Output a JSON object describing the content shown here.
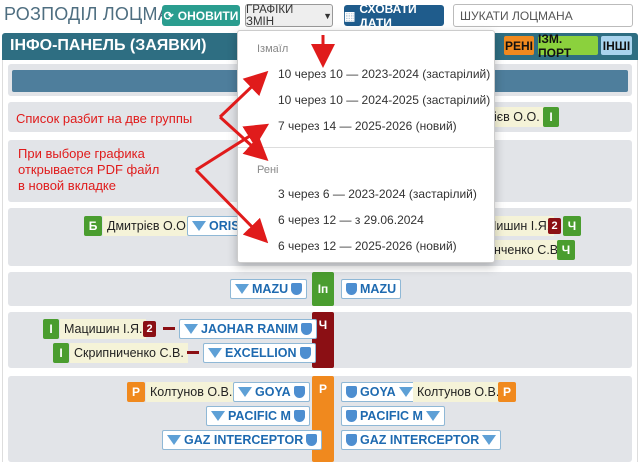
{
  "header": {
    "title": "РОЗПОДІЛ ЛОЦМАНІВ",
    "refresh_label": "ОНОВИТИ",
    "schedules_label": "ГРАФІКИ ЗМІН",
    "hide_dates_label": "СХОВАТИ ДАТИ",
    "search_placeholder": "ШУКАТИ ЛОЦМАНА"
  },
  "panel": {
    "title": "ІНФО-ПАНЕЛЬ (ЗАЯВКИ)",
    "tags": [
      "РЕНІ",
      "ІЗМ. ПОРТ",
      "ІНШІ"
    ]
  },
  "dropdown": {
    "groups": [
      {
        "name": "Ізмаїл",
        "items": [
          "10 через 10 — 2023-2024 (застарілий)",
          "10 через 10 — 2024-2025 (застарілий)",
          "7 через 14 — 2025-2026 (новий)"
        ]
      },
      {
        "name": "Рені",
        "items": [
          "3 через 6 — 2023-2024 (застарілий)",
          "6 через 12 — з 29.06.2024",
          "6 через 12 — 2025-2026 (новий)"
        ]
      }
    ]
  },
  "annotations": {
    "note1": "Список разбит на две группы",
    "note2_line1": "При выборе графика",
    "note2_line2": "открывается PDF файл",
    "note2_line3": "в новой вкладке"
  },
  "rows": {
    "row1": {
      "right_name": "ієв О.О.",
      "right_badge": "І"
    },
    "row2": {
      "left_badge": "Б",
      "left_name": "Дмитрієв О.О.",
      "left_ship": "ORIS",
      "right_name1": "Мишин І.Я.",
      "right_num": "2",
      "right_badge1": "Ч",
      "right_name2": "нченко С.В.",
      "right_badge2": "Ч"
    },
    "row3": {
      "center_badge": "Іп",
      "left_ship": "MAZU",
      "right_ship": "MAZU"
    },
    "row4": {
      "center_badge": "Ч",
      "p1_badge": "І",
      "p1_name": "Мацишин І.Я.",
      "p1_num": "2",
      "p1_ship": "JAOHAR RANIM",
      "p2_badge": "І",
      "p2_name": "Скрипниченко С.В.",
      "p2_ship": "EXCELLION"
    },
    "row5": {
      "center_badge": "Р",
      "l_badge": "Р",
      "l_name": "Колтунов О.В.",
      "l_ship1": "GOYA",
      "l_ship2": "PACIFIC M",
      "l_ship3": "GAZ INTERCEPTOR",
      "r_ship1": "GOYA",
      "r_name": "Колтунов О.В.",
      "r_badge": "Р",
      "r_ship2": "PACIFIC M",
      "r_ship3": "GAZ INTERCEPTOR"
    }
  },
  "colors": {
    "accent": "#2e6e82",
    "annotation": "#e01b1b",
    "green": "#4a9d2f",
    "orange": "#f0891e",
    "red": "#8b0f14"
  }
}
